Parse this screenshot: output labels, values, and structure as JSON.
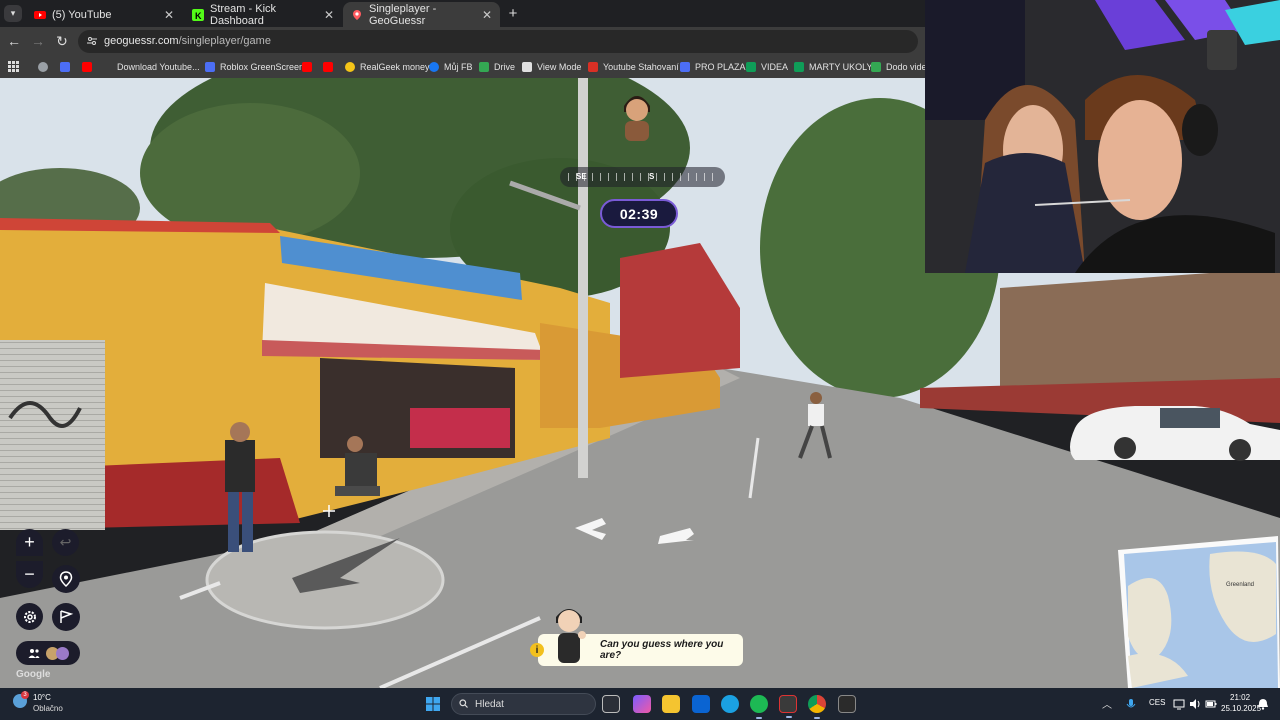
{
  "browser": {
    "tabs": [
      {
        "label": "(5) YouTube",
        "active": false,
        "favicon_color": "#ff0000"
      },
      {
        "label": "Stream - Kick Dashboard",
        "active": false,
        "favicon_color": "#53fc18"
      },
      {
        "label": "Singleplayer - GeoGuessr",
        "active": true,
        "favicon_color": "#f44336"
      }
    ],
    "url_host": "geoguessr.com",
    "url_path": "/singleplayer/game",
    "bookmarks": [
      {
        "label": "",
        "color": "#9aa0a6"
      },
      {
        "label": "",
        "color": "#4c6ef5"
      },
      {
        "label": "",
        "color": "#ff0000"
      },
      {
        "label": "Download Youtube...",
        "color": "#3c3c3c"
      },
      {
        "label": "Roblox GreenScreen",
        "color": "#4c6ef5"
      },
      {
        "label": "",
        "color": "#ff0000"
      },
      {
        "label": "",
        "color": "#ff0000"
      },
      {
        "label": "RealGeek money",
        "color": "#f5c518"
      },
      {
        "label": "Můj FB",
        "color": "#1877f2"
      },
      {
        "label": "Drive",
        "color": "#34a853"
      },
      {
        "label": "View Mode",
        "color": "#e0e0e0"
      },
      {
        "label": "Youtube Stahovaní",
        "color": "#d93025"
      },
      {
        "label": "PRO PLAZA",
        "color": "#4c6ef5"
      },
      {
        "label": "VIDEA",
        "color": "#0f9d58"
      },
      {
        "label": "MARTY UKOLY",
        "color": "#0f9d58"
      },
      {
        "label": "Dodo videa",
        "color": "#34a853"
      }
    ]
  },
  "game": {
    "compass": {
      "left": "SE",
      "center": "S"
    },
    "timer": "02:39",
    "hint": "Can you guess where you are?",
    "hint_icon": "i",
    "google_mark": "Google",
    "minimap_label": "Greenland"
  },
  "taskbar": {
    "weather_temp": "10°C",
    "weather_desc": "Oblačno",
    "weather_badge": "3",
    "search_placeholder": "Hledat",
    "lang": "CES",
    "time": "21:02",
    "date": "25.10.2025",
    "apps": [
      {
        "name": "task-view",
        "color": "#2b2f38"
      },
      {
        "name": "copilot",
        "color": "#7b5cff"
      },
      {
        "name": "file-explorer",
        "color": "#f4c430"
      },
      {
        "name": "outlook",
        "color": "#0a64d2"
      },
      {
        "name": "edge",
        "color": "#1ba1e2"
      },
      {
        "name": "spotify",
        "color": "#1db954"
      },
      {
        "name": "capcut",
        "color": "#3a3a3a"
      },
      {
        "name": "chrome",
        "color": "#db4437"
      },
      {
        "name": "epic-games",
        "color": "#2b2b2b"
      }
    ]
  }
}
